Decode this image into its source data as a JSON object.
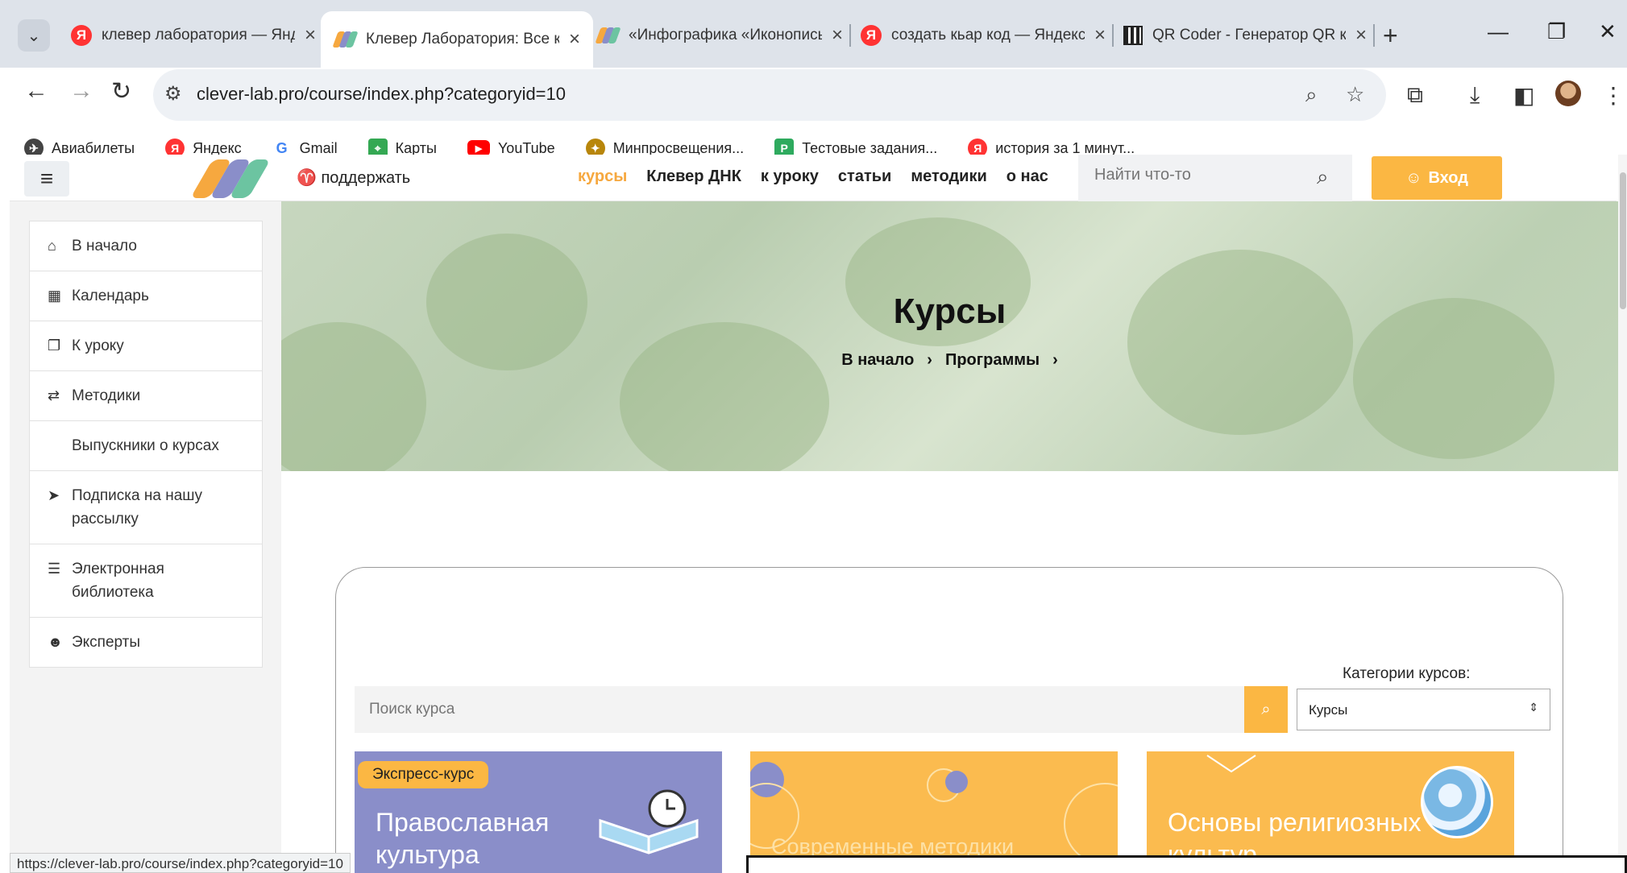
{
  "browser": {
    "tabs": [
      {
        "title": "клевер лаборатория — Яндекс",
        "icon": "yandex",
        "active": false
      },
      {
        "title": "Клевер Лаборатория: Все курсы",
        "icon": "clever",
        "active": true
      },
      {
        "title": "«Инфографика «Иконопись»",
        "icon": "clever",
        "active": false
      },
      {
        "title": "создать кьар код — Яндекс",
        "icon": "yandex",
        "active": false
      },
      {
        "title": "QR Coder - Генератор QR кодов",
        "icon": "qr",
        "active": false
      }
    ],
    "url": "clever-lab.pro/course/index.php?categoryid=10",
    "bookmarks": [
      "Авиабилеты",
      "Яндекс",
      "Gmail",
      "Карты",
      "YouTube",
      "Минпросвещения...",
      "Тестовые задания...",
      "история за 1 минут..."
    ],
    "status_url": "https://clever-lab.pro/course/index.php?categoryid=10"
  },
  "header": {
    "support": "поддержать",
    "nav": [
      "курсы",
      "Клевер ДНК",
      "к уроку",
      "статьи",
      "методики",
      "о нас"
    ],
    "active_nav": "курсы",
    "search_placeholder": "Найти что-то",
    "login": "Вход",
    "accent_color": "#fbb743"
  },
  "sidebar": {
    "items": [
      {
        "label": "В начало",
        "icon": "home-icon"
      },
      {
        "label": "Календарь",
        "icon": "calendar-icon"
      },
      {
        "label": "К уроку",
        "icon": "copy-icon"
      },
      {
        "label": "Методики",
        "icon": "exchange-icon"
      },
      {
        "label": "Выпускники о курсах",
        "icon": ""
      },
      {
        "label": "Подписка на нашу рассылку",
        "icon": "send-icon"
      },
      {
        "label": "Электронная библиотека",
        "icon": "database-icon"
      },
      {
        "label": "Эксперты",
        "icon": "users-icon"
      }
    ]
  },
  "hero": {
    "title": "Курсы",
    "breadcrumb": [
      "В начало",
      "Программы"
    ]
  },
  "catalog": {
    "categories_label": "Категории курсов:",
    "search_placeholder": "Поиск курса",
    "category_selected": "Курсы",
    "cards": [
      {
        "badge": "Экспресс-курс",
        "title": "Православная культура"
      },
      {
        "badge": "",
        "title": "Современные методики"
      },
      {
        "badge": "",
        "title": "Основы религиозных культур"
      }
    ]
  }
}
